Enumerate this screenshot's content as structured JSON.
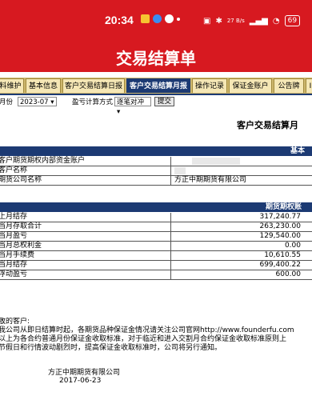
{
  "status_bar": {
    "time": "20:34",
    "network": "27 B/s",
    "battery": "69"
  },
  "header": {
    "title": "交易结算单"
  },
  "tabs": [
    {
      "label": "料维护",
      "active": false
    },
    {
      "label": "基本信息",
      "active": false
    },
    {
      "label": "客户交易结算日报",
      "active": false
    },
    {
      "label": "客户交易结算月报",
      "active": true
    },
    {
      "label": "操作记录",
      "active": false
    },
    {
      "label": "保证金账户",
      "active": false
    },
    {
      "label": "公告牌",
      "active": false
    },
    {
      "label": "I",
      "active": false
    }
  ],
  "filter": {
    "month_label": "月份",
    "month_value": "2023-07",
    "profit_label": "盈亏计算方式",
    "profit_value": "逐笔对冲",
    "submit_label": "提交"
  },
  "report": {
    "title": "客户交易结算月",
    "basic_header": "基本",
    "basic_rows": [
      {
        "label": "客户期货期权内部资金账户",
        "value": ""
      },
      {
        "label": "客户名称",
        "value": ""
      },
      {
        "label": "期货公司名称",
        "value": "方正中期期货有限公司"
      }
    ],
    "account_header": "期货期权账",
    "account_rows": [
      {
        "label": "上月结存",
        "value": "317,240.77"
      },
      {
        "label": "当月存取合计",
        "value": "263,230.00"
      },
      {
        "label": "当月盈亏",
        "value": "129,540.00"
      },
      {
        "label": "当月总权利金",
        "value": "0.00"
      },
      {
        "label": "当月手续费",
        "value": "10,610.55"
      },
      {
        "label": "当月结存",
        "value": "699,400.22"
      },
      {
        "label": "浮动盈亏",
        "value": "600.00"
      }
    ]
  },
  "notice": {
    "lines": [
      "敬的客户:",
      "我公司从即日结算时起，各期货品种保证金情况请关注公司官网http://www.founderfu.com",
      "以上为各合约普通月份保证金收取标准，对于临近和进入交割月合约保证金收取标准原则上",
      "节假日和行情波动剧烈时，提高保证金收取标准时，公司将另行通知。"
    ],
    "company": "方正中期期货有限公司",
    "date": "2017-06-23"
  }
}
